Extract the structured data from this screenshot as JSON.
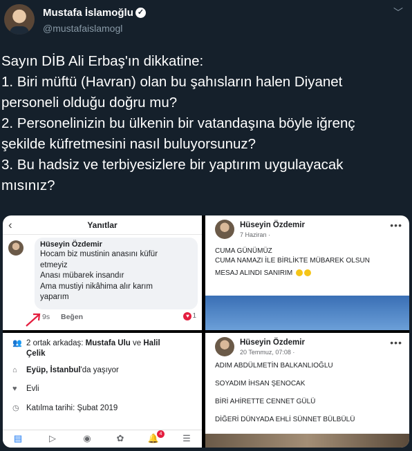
{
  "tweet": {
    "author_name": "Mustafa İslamoğlu",
    "handle": "@mustafaislamogl",
    "lines": [
      "Sayın DİB Ali Erbaş'ın dikkatine:",
      "1. Biri müftü (Havran) olan bu şahısların halen Diyanet",
      "personeli olduğu doğru mu?",
      "2. Personelinizin bu ülkenin bir vatandaşına böyle iğrenç",
      "şekilde küfretmesini nasıl buluyorsunuz?",
      "3. Bu hadsiz ve terbiyesizlere bir yaptırım uygulayacak",
      "mısınız?"
    ],
    "icons": {
      "verified": "verified-badge-icon",
      "menu": "chevron-down-icon"
    }
  },
  "replies_panel": {
    "title": "Yanıtlar",
    "commenter": "Hüseyin Özdemir",
    "comment_lines": [
      "Hocam biz mustinin anasını küfür",
      "etmeyiz",
      "Anası mübarek insandır",
      "Ama mustiyi nikâhima alır karım",
      "yaparım"
    ],
    "time": "9s",
    "like_label": "Beğen",
    "reaction_count": "1"
  },
  "post1": {
    "name": "Hüseyin Özdemir",
    "date": "7 Haziran ·",
    "lines": [
      "CUMA GÜNÜMÜZ",
      "CUMA NAMAZI İLE BİRLİKTE MÜBAREK OLSUN",
      "MESAJ ALINDI SANIRIM"
    ]
  },
  "profile_panel": {
    "mutual_prefix": "2 ortak arkadaş: ",
    "mutual_names": "Mustafa Ulu",
    "mutual_and": " ve ",
    "mutual_names2": "Halil",
    "mutual_names3": "Çelik",
    "lives_place": "Eyüp, İstanbul",
    "lives_suffix": "'da yaşıyor",
    "relationship": "Evli",
    "joined": "Katılma tarihi: Şubat 2019",
    "notif_count": "4"
  },
  "post2": {
    "name": "Hüseyin Özdemir",
    "date": "20 Temmuz, 07:08 ·",
    "lines": [
      "ADIM ABDÜLMETİN BALKANLIOĞLU",
      "SOYADIM İHSAN ŞENOCAK",
      "BİRİ AHİRETTE CENNET GÜLÜ",
      "DİĞERİ DÜNYADA  EHLİ SÜNNET BÜLBÜLÜ"
    ]
  },
  "colors": {
    "bg": "#15202b",
    "muted": "#8899a6",
    "fb_blue": "#1877f2",
    "red": "#e41e3f"
  }
}
